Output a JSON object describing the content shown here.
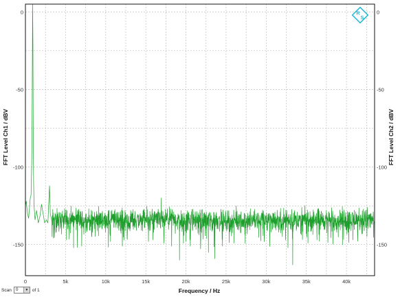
{
  "chart_data": {
    "type": "line",
    "title": "",
    "xlabel": "Frequency / Hz",
    "ylabel_left": "FFT Level Ch1 / dBV",
    "ylabel_right": "FFT Level Ch2 / dBV",
    "xlim": [
      0,
      43500
    ],
    "ylim": [
      -170,
      5
    ],
    "x_ticks": [
      0,
      5000,
      10000,
      15000,
      20000,
      25000,
      30000,
      35000,
      40000
    ],
    "x_tick_labels": [
      "0",
      "5k",
      "10k",
      "15k",
      "20k",
      "25k",
      "30k",
      "35k",
      "40k"
    ],
    "x_minor_step": 2500,
    "y_ticks": [
      0,
      -50,
      -100,
      -150
    ],
    "y_tick_labels": [
      "0",
      "-50",
      "-100",
      "-150"
    ],
    "y_minor_step": 25,
    "grid": true,
    "line_color": "#1e9e2c",
    "series": [
      {
        "points": [
          [
            0,
            -125
          ],
          [
            100,
            -122
          ],
          [
            200,
            -127
          ],
          [
            300,
            -131
          ],
          [
            400,
            -133
          ],
          [
            600,
            -120
          ],
          [
            700,
            -118
          ],
          [
            780,
            -98
          ],
          [
            830,
            -70
          ],
          [
            870,
            -20
          ],
          [
            900,
            5
          ],
          [
            930,
            -20
          ],
          [
            970,
            -72
          ],
          [
            1020,
            -110
          ],
          [
            1080,
            -125
          ],
          [
            1200,
            -134
          ],
          [
            1400,
            -128
          ],
          [
            1600,
            -136
          ],
          [
            1800,
            -132
          ],
          [
            2000,
            -124
          ],
          [
            2400,
            -136
          ],
          [
            2600,
            -134
          ],
          [
            2800,
            -136
          ],
          [
            3000,
            -112
          ],
          [
            3100,
            -130
          ],
          [
            3300,
            -135
          ],
          [
            6000,
            -152
          ],
          [
            10600,
            -148
          ],
          [
            12300,
            -147
          ],
          [
            16900,
            -120
          ],
          [
            17000,
            -128
          ],
          [
            17200,
            -132
          ],
          [
            19200,
            -160
          ],
          [
            20000,
            -148
          ],
          [
            22800,
            -155
          ],
          [
            23600,
            -159
          ],
          [
            26000,
            -149
          ],
          [
            33300,
            -163
          ],
          [
            35200,
            -149
          ],
          [
            39500,
            -150
          ],
          [
            43500,
            -134
          ]
        ],
        "noise_floor_db": -134,
        "noise_spread_db": 10
      }
    ]
  },
  "footer": {
    "scan_label": "Scan",
    "scan_value": "0",
    "of_label": "of 1"
  },
  "logo": {
    "text_top": "R",
    "text_bottom": "S",
    "color": "#1fb6d8"
  },
  "colors": {
    "grid": "#b5b5b5",
    "frame": "#111111",
    "trace": "#1e9e2c"
  }
}
